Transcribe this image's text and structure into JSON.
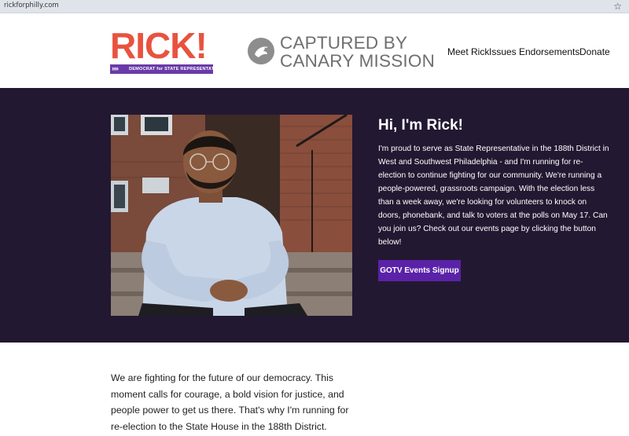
{
  "browser": {
    "url": "rickforphilly.com",
    "bookmark_icon": "star-icon"
  },
  "header": {
    "logo": {
      "main": "RICK!",
      "ribbon": "DEMOCRAT for STATE REPRESENTATIVE",
      "chevrons": "»»"
    },
    "watermark": {
      "line1": "CAPTURED BY",
      "line2": "CANARY MISSION",
      "icon": "canary-bird-icon"
    },
    "nav": [
      "Meet Rick",
      "Issues",
      "Endorsements",
      "Donate"
    ]
  },
  "hero": {
    "title": "Hi, I'm Rick!",
    "body": "I'm proud to serve as State Representative in the 188th District in West and Southwest Philadelphia - and I'm running for re-election to continue fighting for our community. We're running a people-powered, grassroots campaign. With the election less than a week away, we're looking for volunteers to knock on doors, phonebank, and talk to voters at the polls on May 17. Can you join us? Check out our events page by clicking the button below!",
    "button": "GOTV Events Signup"
  },
  "mission": {
    "text": "We are fighting for the future of our democracy. This moment calls for courage, a bold vision for justice, and people power to get us there. That's why I'm running for re-election to the State House in the 188th District."
  },
  "colors": {
    "hero_bg": "#231831",
    "logo_red": "#e8533f",
    "ribbon_purple": "#6a3aa8",
    "button_purple": "#5a22a8"
  }
}
